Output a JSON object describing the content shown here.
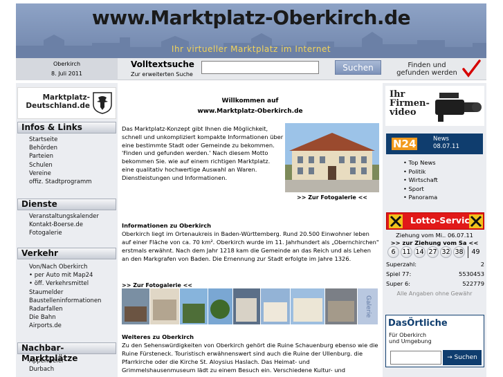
{
  "header": {
    "title": "www.Marktplatz-Oberkirch.de",
    "tagline": "Ihr virtueller Marktplatz im Internet"
  },
  "search": {
    "location": "Oberkirch",
    "date": "8. Juli 2011",
    "title": "Volltextsuche",
    "advanced_link": "Zur erweiterten Suche",
    "input_value": "",
    "button_label": "Suchen",
    "slogan_line1": "Finden und",
    "slogan_line2": "gefunden werden"
  },
  "sidebar": {
    "brand_line1": "Marktplatz-",
    "brand_line2": "Deutschland.de",
    "sections": [
      {
        "title": "Infos & Links",
        "items": [
          "Startseite",
          "Behörden",
          "Parteien",
          "Schulen",
          "Vereine",
          "offiz. Stadtprogramm"
        ]
      },
      {
        "title": "Dienste",
        "items": [
          "Veranstaltungskalender",
          "Kontakt-Boerse.de",
          "Fotogalerie"
        ]
      },
      {
        "title": "Verkehr",
        "items": [
          "Von/Nach Oberkirch",
          "• per Auto mit Map24",
          "• öff. Verkehrsmittel",
          "Staumelder",
          "Baustelleninformationen",
          "Radarfallen",
          "Die Bahn",
          "Airports.de"
        ]
      },
      {
        "title": "Nachbar-Marktplätze",
        "items": [
          "Appenweier",
          "Durbach"
        ]
      }
    ]
  },
  "main": {
    "welcome_line1": "Willkommen auf",
    "welcome_line2": "www.Marktplatz-Oberkirch.de",
    "intro": "Das Marktplatz-Konzept gibt Ihnen die Möglichkeit, schnell und unkompliziert kompakte Informationen über eine bestimmte Stadt oder Gemeinde zu bekommen. 'Finden und gefunden werden.' Nach diesem Motto bekommen Sie. wie auf einem richtigen Marktplatz. eine qualitativ hochwertige Auswahl an Waren. Dienstleistungen und Informationen.",
    "gallery_link": ">> Zur Fotogalerie <<",
    "info_title": "Informationen zu Oberkirch",
    "info_text": "Oberkirch liegt im Ortenaukreis in Baden-Württemberg. Rund 20.500 Einwohner leben auf einer Fläche von ca. 70 km². Oberkirch wurde im 11. Jahrhundert als „Obernchirchen\" erstmals erwähnt. Nach dem Jahr 1218 kam die Gemeinde an das Reich und als Lehen an den Markgrafen von Baden. Die Ernennung zur Stadt erfolgte im Jahre 1326.",
    "gallery_link2": ">> Zur Fotogalerie <<",
    "gallery_label": "Galerie",
    "more_title": "Weiteres zu Oberkirch",
    "more_text": "Zu den Sehenswürdigkeiten von Oberkirch gehört die Ruine Schauenburg ebenso wie die Ruine Fürsteneck. Touristisch erwähnenswert sind auch die Ruine der Ullenburg. die Pfarrkirche oder die Kirche St. Aloysius Haslach. Das Heimat- und Grimmelshausenmuseum lädt zu einem Besuch ein. Verschiedene Kultur- und"
  },
  "right": {
    "video_line1": "Ihr",
    "video_line2": "Firmen-",
    "video_line3": "video",
    "n24_logo": "N24",
    "n24_news": "News",
    "n24_date": "08.07.11",
    "news_items": [
      "• Top News",
      "• Politik",
      "• Wirtschaft",
      "• Sport",
      "• Panorama"
    ],
    "lotto_title": "Lotto-Service",
    "draw_line1": "Ziehung vom Mi.. 06.07.11",
    "draw_line2": ">> zur Ziehung vom Sa <<",
    "numbers": [
      "6",
      "11",
      "14",
      "27",
      "32",
      "38"
    ],
    "superzahl_ball": "49",
    "stats": [
      {
        "label": "Superzahl:",
        "value": "2"
      },
      {
        "label": "Spiel 77:",
        "value": "5530453"
      },
      {
        "label": "Super 6:",
        "value": "522779"
      }
    ],
    "disclaimer": "Alle Angaben ohne Gewähr",
    "oertliche_logo": "DasÖrtliche",
    "oertliche_sub1": "Für Oberkirch",
    "oertliche_sub2": "und Umgebung",
    "oertliche_button": "→ Suchen"
  },
  "colors": {
    "header_blue": "#7f94b8",
    "tagline_yellow": "#f2d35a",
    "sidebar_grey": "#ebedf1",
    "lotto_red": "#e11919",
    "n24_blue": "#0f3d6e"
  }
}
